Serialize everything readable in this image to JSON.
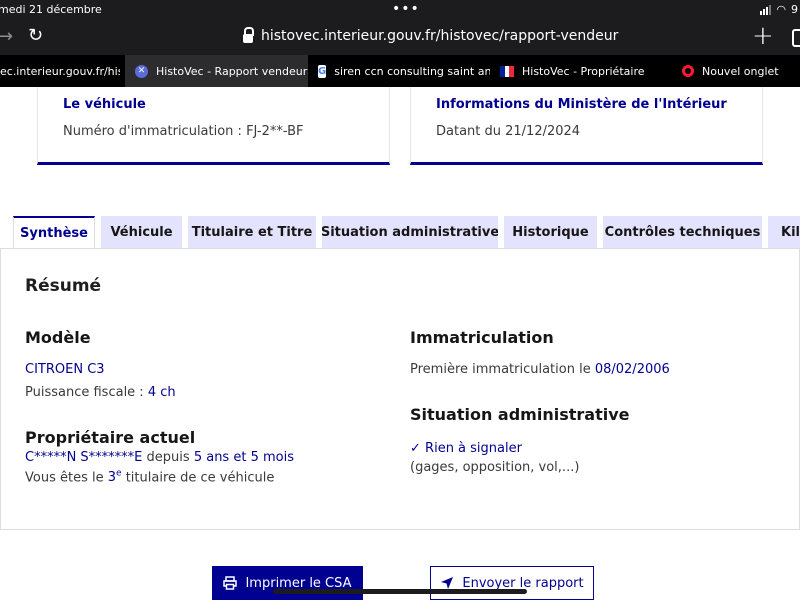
{
  "status_bar": {
    "time": "medi 21 décembre",
    "battery": "9"
  },
  "address_bar": {
    "url": "histovec.interieur.gouv.fr/histovec/rapport-vendeur"
  },
  "browser_tabs": [
    {
      "title": "ec.interieur.gouv.fr/histo..."
    },
    {
      "title": "HistoVec - Rapport vendeur",
      "favicon": "x-icon"
    },
    {
      "title": "siren ccn consulting saint and...",
      "favicon": "google-icon"
    },
    {
      "title": "HistoVec - Propriétaire",
      "favicon": "french-flag-icon"
    },
    {
      "title": "Nouvel onglet",
      "favicon": "opera-icon"
    }
  ],
  "cards": {
    "vehicle": {
      "title": "Le véhicule",
      "text": "Numéro d'immatriculation : FJ-2**-BF"
    },
    "ministry": {
      "title": "Informations du Ministère de l'Intérieur",
      "text": "Datant du 21/12/2024"
    }
  },
  "tabs": [
    "Synthèse",
    "Véhicule",
    "Titulaire et Titre",
    "Situation administrative",
    "Historique",
    "Contrôles techniques",
    "Kilo"
  ],
  "summary": {
    "title": "Résumé",
    "model": {
      "heading": "Modèle",
      "name": "CITROEN C3",
      "power_label": "Puissance fiscale :",
      "power_value": "4 ch"
    },
    "owner": {
      "heading": "Propriétaire actuel",
      "name": "C*****N S*******E",
      "since_label": "depuis",
      "since_value": "5 ans et 5 mois",
      "rank_prefix": "Vous êtes le",
      "rank_value": "3",
      "rank_sup": "e",
      "rank_suffix": "titulaire de ce véhicule"
    },
    "registration": {
      "heading": "Immatriculation",
      "label": "Première immatriculation le",
      "date": "08/02/2006"
    },
    "admin": {
      "heading": "Situation administrative",
      "status": "Rien à signaler",
      "details": "(gages, opposition, vol,...)"
    }
  },
  "actions": {
    "print": "Imprimer le CSA",
    "send": "Envoyer le rapport"
  },
  "colors": {
    "primary": "#000091",
    "tab_bg": "#e3e3fd"
  }
}
